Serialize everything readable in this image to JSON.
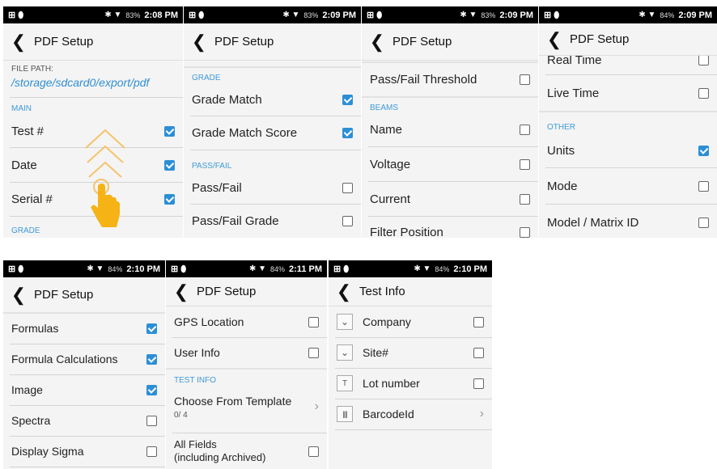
{
  "accent_color": "#3f9ad8",
  "checkbox_color": "#2c8fd6",
  "back_icon": "chevron-left-icon",
  "screens": [
    {
      "status": {
        "left": "⊞ ⬮",
        "icons": "✱ ▼",
        "battery": "83%",
        "time": "2:08 PM"
      },
      "title": "PDF Setup",
      "file_path_label": "FILE PATH:",
      "file_path_value": "/storage/sdcard0/export/pdf",
      "sections": [
        "MAIN",
        "GRADE"
      ],
      "items": [
        {
          "label": "Test #",
          "checked": true
        },
        {
          "label": "Date",
          "checked": true
        },
        {
          "label": "Serial #",
          "checked": true
        }
      ],
      "gesture": "swipe-up-hand-icon"
    },
    {
      "status": {
        "left": "⊞ ⬮",
        "icons": "✱ ▼",
        "battery": "83%",
        "time": "2:09 PM"
      },
      "title": "PDF Setup",
      "sections": [
        "GRADE",
        "PASS/FAIL"
      ],
      "items": [
        {
          "label": "Grade Match",
          "checked": true
        },
        {
          "label": "Grade Match Score",
          "checked": true
        },
        {
          "label": "Pass/Fail",
          "checked": false
        },
        {
          "label": "Pass/Fail Grade",
          "checked": false
        }
      ]
    },
    {
      "status": {
        "left": "⊞ ⬮",
        "icons": "✱ ▼",
        "battery": "83%",
        "time": "2:09 PM"
      },
      "title": "PDF Setup",
      "sections": [
        "BEAMS"
      ],
      "items": [
        {
          "label": "Pass/Fail Threshold",
          "checked": false
        },
        {
          "label": "Name",
          "checked": false
        },
        {
          "label": "Voltage",
          "checked": false
        },
        {
          "label": "Current",
          "checked": false
        },
        {
          "label": "Filter Position",
          "checked": false
        }
      ]
    },
    {
      "status": {
        "left": "⊞ ⬮",
        "icons": "✱ ▼",
        "battery": "84%",
        "time": "2:09 PM"
      },
      "title": "PDF Setup",
      "sections": [
        "OTHER"
      ],
      "items": [
        {
          "label": "Real Time",
          "checked": false
        },
        {
          "label": "Live Time",
          "checked": false
        },
        {
          "label": "Units",
          "checked": true
        },
        {
          "label": "Mode",
          "checked": false
        },
        {
          "label": "Model / Matrix ID",
          "checked": false
        }
      ]
    },
    {
      "status": {
        "left": "⊞ ⬮",
        "icons": "✱ ▼",
        "battery": "84%",
        "time": "2:10 PM"
      },
      "title": "PDF Setup",
      "items": [
        {
          "label": "Formulas",
          "checked": true
        },
        {
          "label": "Formula Calculations",
          "checked": true
        },
        {
          "label": "Image",
          "checked": true
        },
        {
          "label": "Spectra",
          "checked": false
        },
        {
          "label": "Display Sigma",
          "checked": false
        }
      ]
    },
    {
      "status": {
        "left": "⊞ ⬮",
        "icons": "✱ ▼",
        "battery": "84%",
        "time": "2:11 PM"
      },
      "title": "PDF Setup",
      "sections": [
        "TEST INFO"
      ],
      "items": [
        {
          "label": "GPS Location",
          "checked": false
        },
        {
          "label": "User Info",
          "checked": false
        },
        {
          "label": "Choose From Template",
          "sub": "0/ 4"
        },
        {
          "label": "All Fields\n(including Archived)",
          "checked": false
        }
      ]
    },
    {
      "status": {
        "left": "⊞ ⬮",
        "icons": "✱ ▼",
        "battery": "84%",
        "time": "2:10 PM"
      },
      "title": "Test Info",
      "items": [
        {
          "label": "Company",
          "icon": "v",
          "checked": false
        },
        {
          "label": "Site#",
          "icon": "v",
          "checked": false
        },
        {
          "label": "Lot number",
          "icon": "T",
          "checked": false
        },
        {
          "label": "BarcodeId",
          "icon": "||||"
        }
      ]
    }
  ]
}
